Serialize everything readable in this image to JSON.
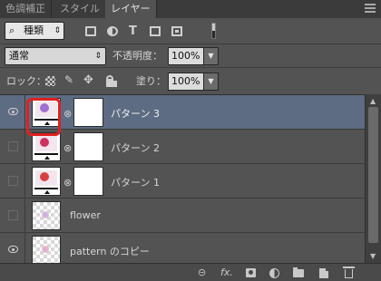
{
  "tabs": [
    {
      "label": "色調補正",
      "active": false
    },
    {
      "label": "スタイル",
      "active": false
    },
    {
      "label": "レイヤー",
      "active": true
    }
  ],
  "filter": {
    "kind_label": "種類",
    "search_glyph": "⌕",
    "arrow": "⇕"
  },
  "blend": {
    "mode": "通常",
    "arrow": "⇕",
    "opacity_label": "不透明度：",
    "opacity_value": "100%",
    "fill_label": "塗り：",
    "fill_value": "100%",
    "stepper": "▼"
  },
  "lock": {
    "label": "ロック：",
    "brush_glyph": "✎",
    "move_glyph": "✥"
  },
  "layers": [
    {
      "name": "パターン 3",
      "visible": true,
      "selected": true,
      "flower_color": "#a070d0",
      "has_mask": true,
      "chain": "⊗"
    },
    {
      "name": "パターン 2",
      "visible": false,
      "selected": false,
      "flower_color": "#d03060",
      "has_mask": true,
      "chain": "⊗"
    },
    {
      "name": "パターン 1",
      "visible": false,
      "selected": false,
      "flower_color": "#d84040",
      "has_mask": true,
      "chain": "⊗"
    },
    {
      "name": "flower",
      "visible": false,
      "selected": false,
      "flower_color": "#c9a3d7",
      "has_mask": false
    },
    {
      "name": "pattern のコピー",
      "visible": true,
      "selected": false,
      "flower_color": "#e0a0c0",
      "has_mask": false
    }
  ],
  "footer": {
    "link": "⊝",
    "fx": "fx.",
    "adjust": "◐"
  },
  "scroll": {
    "up": "▲",
    "down": "▼"
  },
  "colors": {
    "panel_bg": "#535353",
    "selected_row": "#5d6c82",
    "highlight": "#e02020"
  }
}
